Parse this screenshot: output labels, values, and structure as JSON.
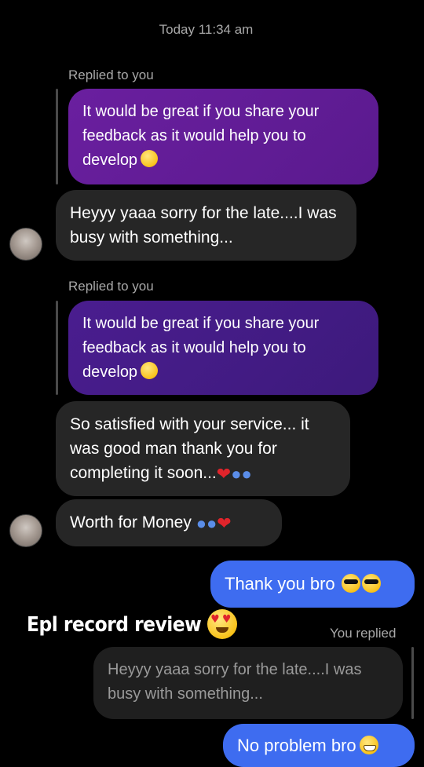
{
  "header": {
    "timestamp": "Today 11:34 am"
  },
  "messages": {
    "reply1": {
      "label": "Replied to you",
      "quoted": "It would be great if you share your feedback as it would help you to develop",
      "text": "Heyyy yaaa sorry for the late....I was busy with something..."
    },
    "reply2": {
      "label": "Replied to you",
      "quoted": "It would be great if you share your feedback as it would help you to develop",
      "text": "So satisfied with your service... it was good man thank you for completing it soon..."
    },
    "worth": {
      "text": "Worth for Money"
    },
    "thank": {
      "text": "Thank you bro"
    },
    "overlay": {
      "text": "Epl record review"
    },
    "you_replied": {
      "label": "You replied",
      "quoted": "Heyyy yaaa sorry for the late....I was busy with something...",
      "text": "No problem bro"
    }
  },
  "colors": {
    "background": "#000000",
    "purple_bubble": "#5a1a8e",
    "gray_bubble": "#262626",
    "blue_bubble": "#3e6cf0"
  },
  "icons": [
    "avatar",
    "smile-emoji",
    "heart-emoji",
    "people-emoji",
    "sunglasses-emoji",
    "heart-eyes-emoji",
    "grin-emoji"
  ]
}
